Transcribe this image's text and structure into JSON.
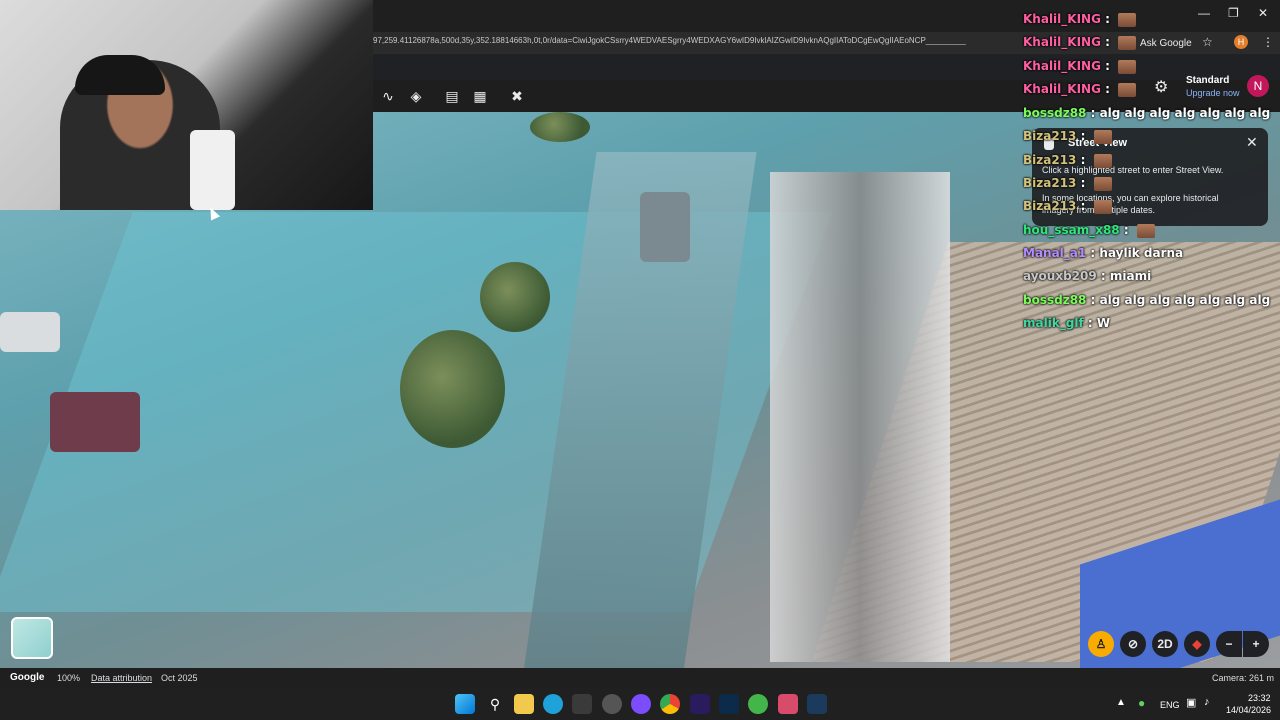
{
  "browser": {
    "url": "97,259.41126878a,500d,35y,352.18814663h,0t,0r/data=CiwiJgokCSsrry4WEDVAESgrry4WEDXAGY6wID9IvklAIZGwID9IvknAQgIIAToDCgEwQgIIAEoNCP_________",
    "ask_google": "Ask Google",
    "profile_letter": "H"
  },
  "maps": {
    "account_tier": "Standard",
    "upgrade_label": "Upgrade now",
    "avatar_letter": "N"
  },
  "street_view_card": {
    "title": "Street View",
    "line1": "Click a highlighted street to enter Street View.",
    "line2": "In some locations, you can explore historical imagery from multiple dates."
  },
  "chat": [
    {
      "user": "Khalil_KING",
      "color": "#ff5fa2",
      "msg": "",
      "emote": true
    },
    {
      "user": "Khalil_KING",
      "color": "#ff5fa2",
      "msg": "",
      "emote": true
    },
    {
      "user": "Khalil_KING",
      "color": "#ff5fa2",
      "msg": "",
      "emote": true
    },
    {
      "user": "Khalil_KING",
      "color": "#ff5fa2",
      "msg": "",
      "emote": true
    },
    {
      "user": "bossdz88",
      "color": "#7cfc5a",
      "msg": "alg alg alg alg alg alg alg",
      "emote": false
    },
    {
      "user": "Biza213",
      "color": "#d4c27a",
      "msg": "",
      "emote": true
    },
    {
      "user": "Biza213",
      "color": "#d4c27a",
      "msg": "",
      "emote": true
    },
    {
      "user": "Biza213",
      "color": "#d4c27a",
      "msg": "",
      "emote": true
    },
    {
      "user": "Biza213",
      "color": "#d4c27a",
      "msg": "",
      "emote": true
    },
    {
      "user": "hou_ssam_x88",
      "color": "#2ee67a",
      "msg": "",
      "emote": true
    },
    {
      "user": "Manal_a1",
      "color": "#b48cff",
      "msg": "haylik darna",
      "emote": false
    },
    {
      "user": "ayouxb209",
      "color": "#c8c8c8",
      "msg": "miami",
      "emote": false
    },
    {
      "user": "bossdz88",
      "color": "#7cfc5a",
      "msg": "alg alg alg alg alg alg alg",
      "emote": false
    },
    {
      "user": "malik_glf",
      "color": "#3fd6a0",
      "msg": "W",
      "emote": false
    }
  ],
  "map_controls": {
    "mode_2d": "2D"
  },
  "status": {
    "google_logo": "Google",
    "zoom": "100%",
    "attribution": "Data attribution",
    "date": "Oct 2025",
    "camera": "Camera: 261 m"
  },
  "taskbar": {
    "lang": "ENG",
    "time": "23:32",
    "date": "14/04/2026"
  }
}
